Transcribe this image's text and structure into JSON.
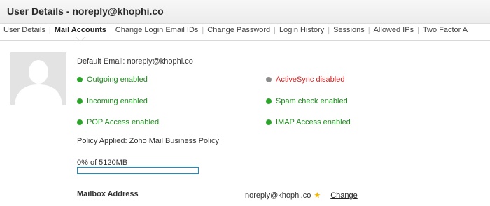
{
  "window": {
    "title": "User Details - noreply@khophi.co"
  },
  "tabs": [
    {
      "label": "User Details"
    },
    {
      "label": "Mail Accounts"
    },
    {
      "label": "Change Login Email IDs"
    },
    {
      "label": "Change Password"
    },
    {
      "label": "Login History"
    },
    {
      "label": "Sessions"
    },
    {
      "label": "Allowed IPs"
    },
    {
      "label": "Two Factor A"
    }
  ],
  "account": {
    "default_email": "Default Email: noreply@khophi.co",
    "statuses": {
      "outgoing": "Outgoing enabled",
      "incoming": "Incoming enabled",
      "pop": "POP Access enabled",
      "activesync": "ActiveSync disabled",
      "spam": "Spam check enabled",
      "imap": "IMAP Access enabled"
    },
    "policy": "Policy Applied:  Zoho Mail Business Policy",
    "quota_text": "0% of 5120MB",
    "quota_fraction": 0,
    "mailbox_label": "Mailbox Address",
    "mailbox_value": "noreply@khophi.co",
    "change_link": "Change"
  },
  "colors": {
    "enabled": "#2aa52a",
    "disabled": "#8c8c8c",
    "progress_border": "#1a8dc9"
  }
}
